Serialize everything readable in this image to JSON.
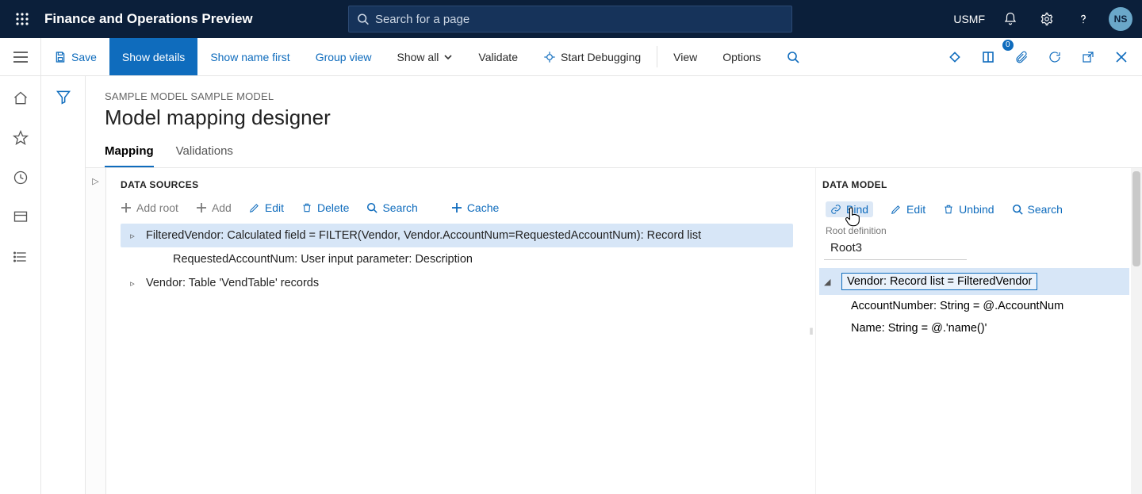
{
  "appbar": {
    "title": "Finance and Operations Preview",
    "search_placeholder": "Search for a page",
    "org": "USMF",
    "avatar": "NS"
  },
  "cmdbar": {
    "save": "Save",
    "show_details": "Show details",
    "show_name_first": "Show name first",
    "group_view": "Group view",
    "show_all": "Show all",
    "validate": "Validate",
    "start_debugging": "Start Debugging",
    "view": "View",
    "options": "Options",
    "badge_count": "0"
  },
  "page": {
    "breadcrumb": "SAMPLE MODEL SAMPLE MODEL",
    "title": "Model mapping designer",
    "tabs": {
      "mapping": "Mapping",
      "validations": "Validations"
    }
  },
  "data_sources": {
    "title": "DATA SOURCES",
    "toolbar": {
      "add_root": "Add root",
      "add": "Add",
      "edit": "Edit",
      "delete": "Delete",
      "search": "Search",
      "cache": "Cache"
    },
    "items": [
      {
        "text": "FilteredVendor: Calculated field = FILTER(Vendor, Vendor.AccountNum=RequestedAccountNum): Record list",
        "caret": "▹",
        "selected": true,
        "indent": 0
      },
      {
        "text": "RequestedAccountNum: User input parameter: Description",
        "caret": "",
        "selected": false,
        "indent": 1
      },
      {
        "text": "Vendor: Table 'VendTable' records",
        "caret": "▹",
        "selected": false,
        "indent": 0
      }
    ]
  },
  "data_model": {
    "title": "DATA MODEL",
    "toolbar": {
      "bind": "Bind",
      "edit": "Edit",
      "unbind": "Unbind",
      "search": "Search"
    },
    "root_definition_label": "Root definition",
    "root_definition_value": "Root3",
    "items": [
      {
        "text": "Vendor: Record list = FilteredVendor",
        "caret": "◢",
        "selected": true,
        "indent": 0
      },
      {
        "text": "AccountNumber: String = @.AccountNum",
        "caret": "",
        "selected": false,
        "indent": 1
      },
      {
        "text": "Name: String = @.'name()'",
        "caret": "",
        "selected": false,
        "indent": 1
      }
    ]
  },
  "icons": {
    "save": "save",
    "link": "link",
    "edit": "edit",
    "trash": "trash",
    "search": "search",
    "plus": "plus",
    "chevron_down": "chevron_down"
  },
  "colors": {
    "accent": "#0f6cbd",
    "appbar": "#0b1f3a",
    "selection": "#d7e6f7"
  }
}
